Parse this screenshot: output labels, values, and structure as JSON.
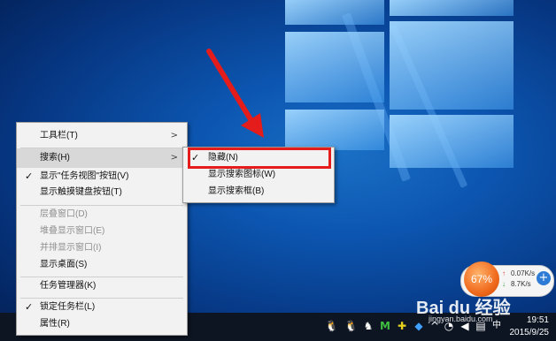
{
  "context_menu": {
    "items": [
      {
        "label": "工具栏(T)",
        "submenu": true
      },
      {
        "label": "搜索(H)",
        "submenu": true,
        "highlighted": true
      },
      {
        "label": "显示\"任务视图\"按钮(V)",
        "checked": true
      },
      {
        "label": "显示触摸键盘按钮(T)"
      },
      {
        "label": "层叠窗口(D)",
        "disabled": true
      },
      {
        "label": "堆叠显示窗口(E)",
        "disabled": true
      },
      {
        "label": "并排显示窗口(I)",
        "disabled": true
      },
      {
        "label": "显示桌面(S)"
      },
      {
        "label": "任务管理器(K)"
      },
      {
        "label": "锁定任务栏(L)",
        "checked": true
      },
      {
        "label": "属性(R)"
      }
    ]
  },
  "submenu": {
    "items": [
      {
        "label": "隐藏(N)",
        "checked": true
      },
      {
        "label": "显示搜索图标(W)"
      },
      {
        "label": "显示搜索框(B)"
      }
    ]
  },
  "speed_widget": {
    "percent": "67%",
    "up": "0.07K/s",
    "down": "8.7K/s"
  },
  "clock": {
    "time": "19:51",
    "date": "2015/9/25"
  },
  "watermark": {
    "brand": "Bai du 经验",
    "url": "jingyan.baidu.com"
  },
  "tray": {
    "ime": "中"
  },
  "colors": {
    "highlight_box": "#e41c1c",
    "arrow": "#e41c1c",
    "accent": "#0c56b1"
  }
}
